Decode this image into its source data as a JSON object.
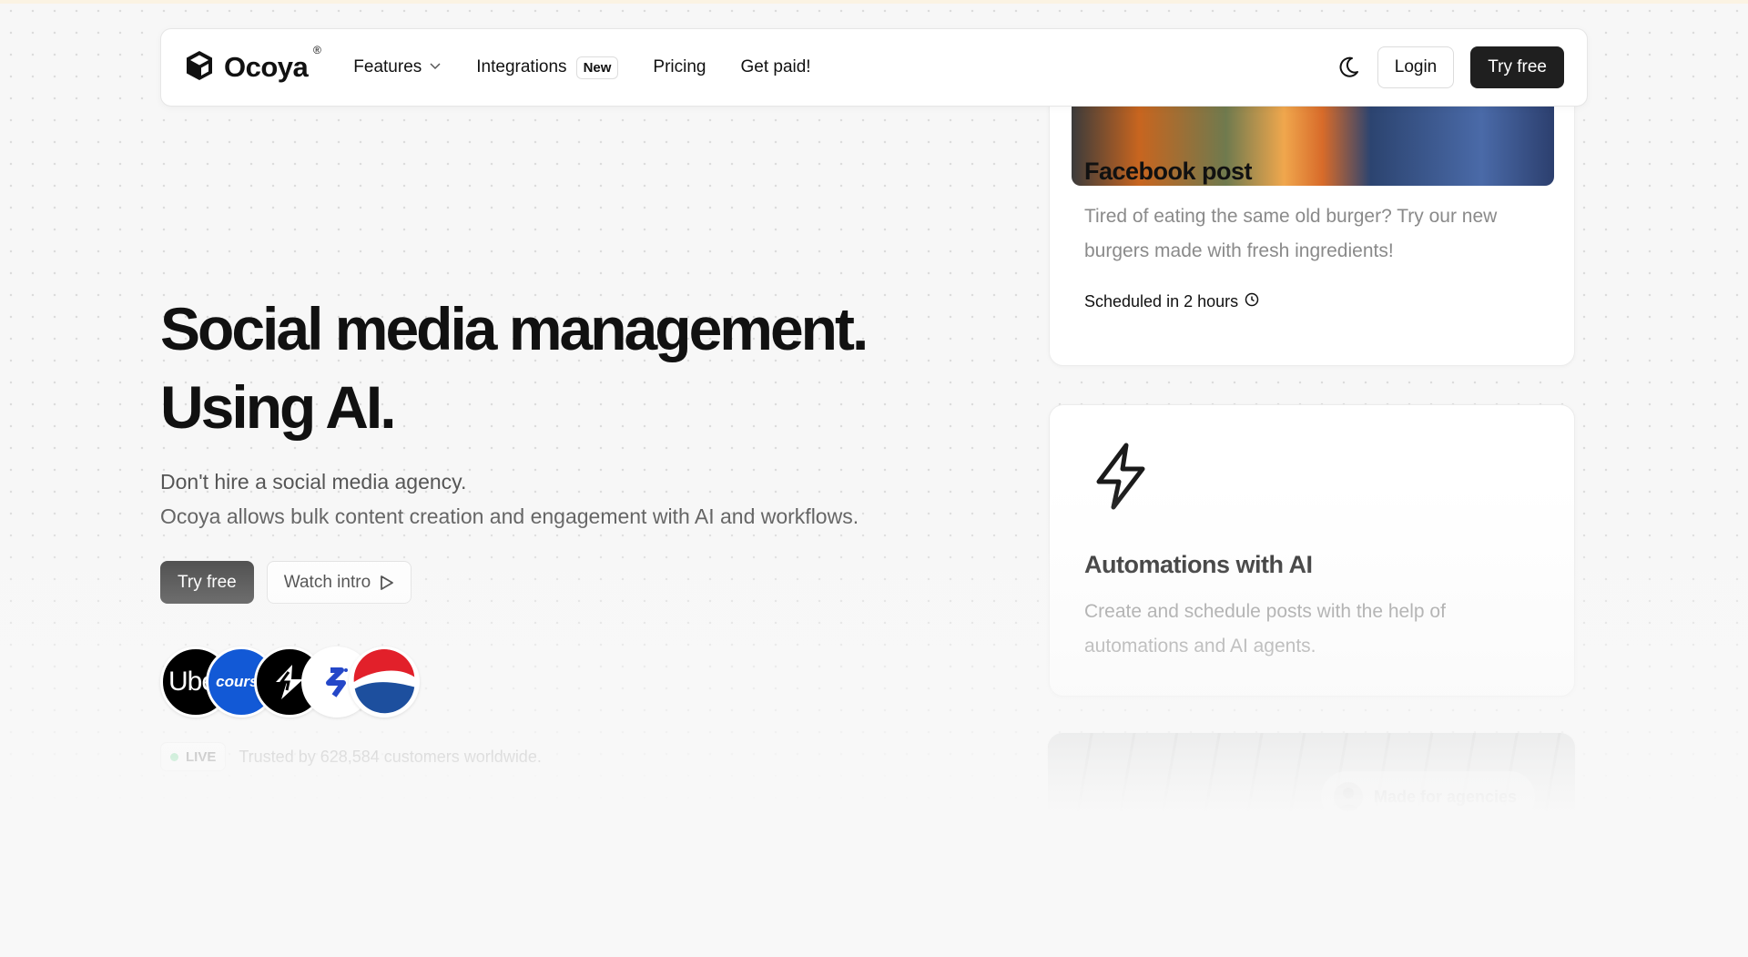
{
  "brand": {
    "name": "Ocoya",
    "reg_mark": "®"
  },
  "nav": {
    "features": "Features",
    "integrations": "Integrations",
    "integrations_badge": "New",
    "pricing": "Pricing",
    "get_paid": "Get paid!",
    "login": "Login",
    "try_free": "Try free"
  },
  "hero": {
    "title_line1": "Social media management.",
    "title_line2": "Using AI.",
    "sub_line1": "Don't hire a social media agency.",
    "sub_line2": "Ocoya allows bulk content creation and engagement with AI and workflows.",
    "try_free": "Try free",
    "watch_intro": "Watch intro"
  },
  "brands": [
    {
      "name": "Uber",
      "visible_text": "Ube"
    },
    {
      "name": "Coursera",
      "visible_text": "course"
    },
    {
      "name": "Brand 3"
    },
    {
      "name": "Brand 4"
    },
    {
      "name": "Pepsi"
    }
  ],
  "live": {
    "badge": "LIVE",
    "text": "Trusted by 628,584 customers worldwide."
  },
  "cards": {
    "facebook": {
      "title": "Facebook post",
      "desc": "Tired of eating the same old burger? Try our new burgers made with fresh ingredients!",
      "scheduled": "Scheduled in 2 hours"
    },
    "automations": {
      "title": "Automations with AI",
      "desc": "Create and schedule posts with the help of automations and AI agents."
    },
    "agencies": {
      "pill": "Made for agencies"
    }
  },
  "icons": [
    "ocoya-logo-icon",
    "chevron-down-icon",
    "moon-icon",
    "play-icon",
    "clock-icon",
    "lightning-bolt-icon",
    "avatar-icon"
  ],
  "colors": {
    "dark_button": "#1f1f1f",
    "live_dot": "#22c55e",
    "coursera_blue": "#1259d6",
    "muted_text": "#8a8a8a"
  }
}
